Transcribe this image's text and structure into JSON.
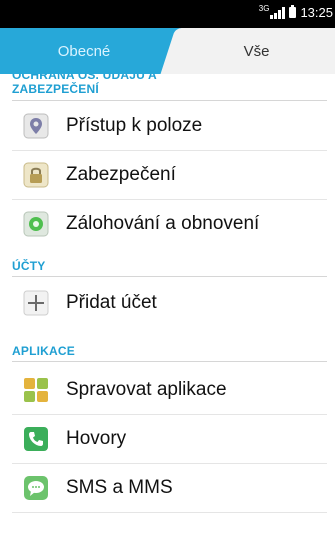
{
  "status_bar": {
    "network": "3G",
    "time": "13:25"
  },
  "tabs": {
    "general": "Obecné",
    "all": "Vše"
  },
  "sections": {
    "privacy_partial": "OCHRANA OS. ÚDAJŮ A",
    "privacy_line2": "ZABEZPEČENÍ",
    "accounts": "ÚČTY",
    "apps": "APLIKACE"
  },
  "items": {
    "location": "Přístup k poloze",
    "security": "Zabezpečení",
    "backup": "Zálohování a obnovení",
    "add_account": "Přidat účet",
    "manage_apps": "Spravovat aplikace",
    "calls": "Hovory",
    "sms": "SMS a MMS"
  }
}
